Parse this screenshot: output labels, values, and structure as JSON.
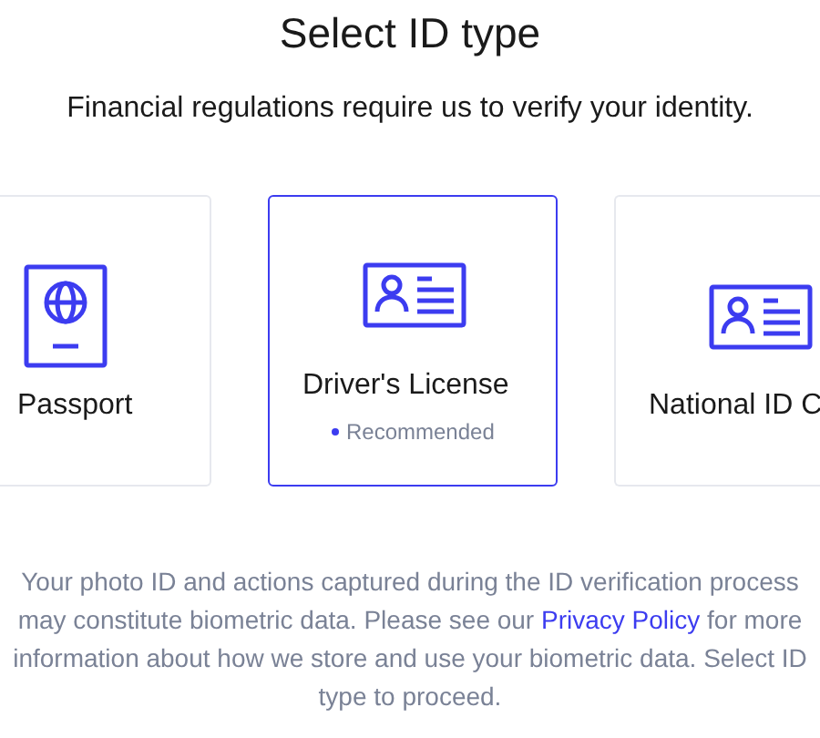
{
  "title": "Select ID type",
  "subtitle": "Financial regulations require us to verify your identity.",
  "id_types": [
    {
      "kind": "passport",
      "label": "Passport",
      "selected": false
    },
    {
      "kind": "card",
      "label": "Driver's License",
      "note": "Recommended",
      "selected": true
    },
    {
      "kind": "card",
      "label": "National ID C",
      "selected": false
    }
  ],
  "disclaimer": {
    "before": "Your photo ID and actions captured during the ID verification process may constitute biometric data. Please see our",
    "link": "Privacy Policy",
    "after": "for more information about how we store and use your biometric data. Select ID type to proceed."
  }
}
